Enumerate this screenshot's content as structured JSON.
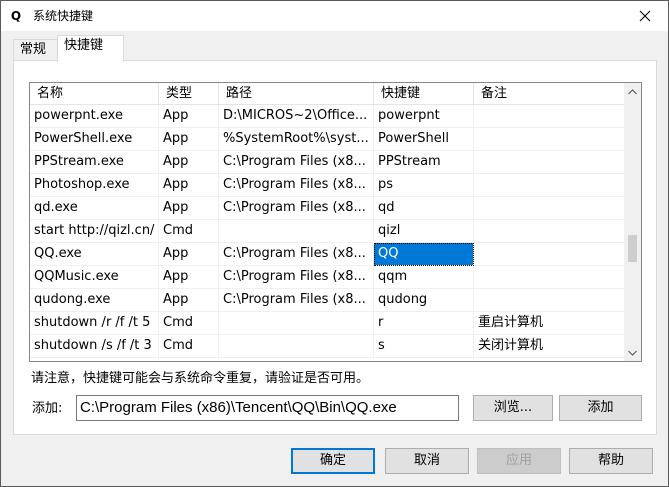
{
  "window": {
    "icon_glyph": "Q",
    "title": "系统快捷键"
  },
  "tabs": [
    {
      "label": "常规",
      "active": false
    },
    {
      "label": "快捷键",
      "active": true
    }
  ],
  "grid": {
    "columns": [
      "名称",
      "类型",
      "路径",
      "快捷键",
      "备注"
    ],
    "rows": [
      [
        "powerpnt.exe",
        "App",
        "D:\\MICROS~2\\Office...",
        "powerpnt",
        ""
      ],
      [
        "PowerShell.exe",
        "App",
        "%SystemRoot%\\syst...",
        "PowerShell",
        ""
      ],
      [
        "PPStream.exe",
        "App",
        "C:\\Program Files (x8...",
        "PPStream",
        ""
      ],
      [
        "Photoshop.exe",
        "App",
        "C:\\Program Files (x8...",
        "ps",
        ""
      ],
      [
        "qd.exe",
        "App",
        "C:\\Program Files (x8...",
        "qd",
        ""
      ],
      [
        "start http://qizl.cn/",
        "Cmd",
        "",
        "qizl",
        ""
      ],
      [
        "QQ.exe",
        "App",
        "C:\\Program Files (x8...",
        "QQ",
        ""
      ],
      [
        "QQMusic.exe",
        "App",
        "C:\\Program Files (x8...",
        "qqm",
        ""
      ],
      [
        "qudong.exe",
        "App",
        "C:\\Program Files (x8...",
        "qudong",
        ""
      ],
      [
        "shutdown /r /f /t 5",
        "Cmd",
        "",
        "r",
        "重启计算机"
      ],
      [
        "shutdown /s /f /t 3",
        "Cmd",
        "",
        "s",
        "关闭计算机"
      ]
    ],
    "selected": {
      "row": 6,
      "col": 3
    },
    "scroll_fraction": 0.62
  },
  "notice": "请注意，快捷键可能会与系统命令重复，请验证是否可用。",
  "add": {
    "label": "添加:",
    "value": "C:\\Program Files (x86)\\Tencent\\QQ\\Bin\\QQ.exe",
    "browse_button": "浏览...",
    "add_button": "添加"
  },
  "footer": {
    "ok": "确定",
    "cancel": "取消",
    "apply": "应用",
    "help": "帮助"
  },
  "colors": {
    "selection": "#0078d7",
    "window_bg": "#f0f0f0"
  }
}
